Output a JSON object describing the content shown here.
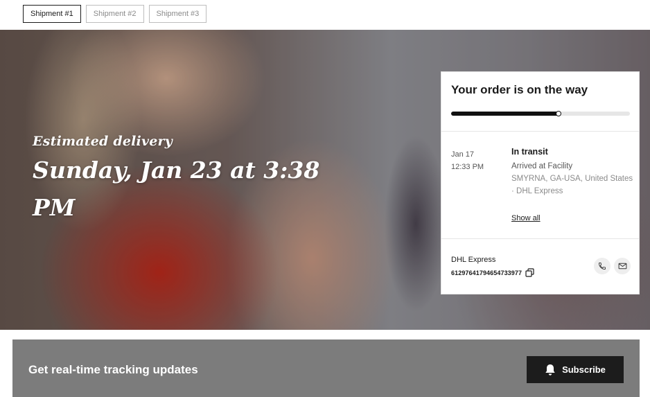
{
  "tabs": [
    {
      "label": "Shipment #1",
      "active": true
    },
    {
      "label": "Shipment #2",
      "active": false
    },
    {
      "label": "Shipment #3",
      "active": false
    }
  ],
  "hero": {
    "estimated_label": "Estimated delivery",
    "delivery_date_line1": "Sunday, Jan 23 at 3:38",
    "delivery_date_line2": "PM"
  },
  "order_card": {
    "title": "Your order is on the way",
    "progress": 0.6,
    "event": {
      "date": "Jan 17",
      "time": "12:33 PM",
      "status": "In transit",
      "description": "Arrived at Facility",
      "location": "SMYRNA, GA-USA, United States · DHL Express"
    },
    "show_all_label": "Show all",
    "carrier": "DHL Express",
    "tracking_number": "61297641794654733977",
    "icons": {
      "copy": "copy-icon",
      "phone": "phone-icon",
      "email": "mail-icon"
    }
  },
  "subscribe": {
    "text": "Get real-time tracking updates",
    "button_label": "Subscribe",
    "icon": "bell-icon"
  },
  "colors": {
    "accent": "#111111",
    "subscribe_bar": "#7c7c7c",
    "subscribe_button": "#1c1c1c"
  }
}
